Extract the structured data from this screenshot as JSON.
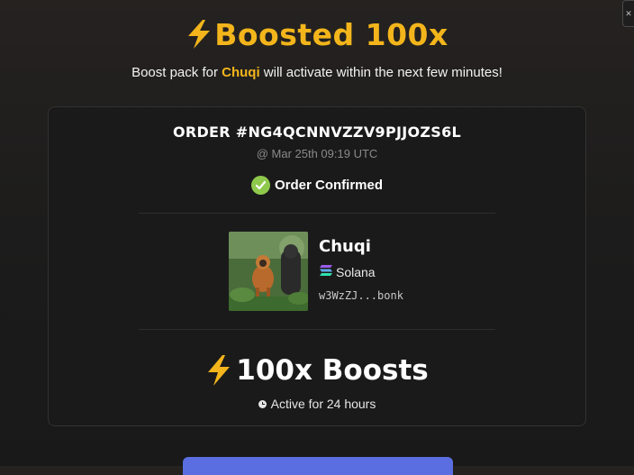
{
  "header": {
    "title": "Boosted 100x",
    "subtitle_prefix": "Boost pack for ",
    "token_name": "Chuqi",
    "subtitle_suffix": " will activate within the next few minutes!"
  },
  "order": {
    "id_label": "ORDER #NG4QCNNVZZV9PJJOZS6L",
    "date": "@ Mar 25th 09:19 UTC",
    "status": "Order Confirmed"
  },
  "token": {
    "name": "Chuqi",
    "chain": "Solana",
    "address": "w3WzZJ...bonk",
    "image_icon": "monkey-photo"
  },
  "boost": {
    "amount": "100x Boosts",
    "duration": "Active for 24 hours"
  },
  "colors": {
    "accent": "#f3b51b",
    "confirmed": "#8fc94c",
    "button": "#5b6ee1"
  }
}
